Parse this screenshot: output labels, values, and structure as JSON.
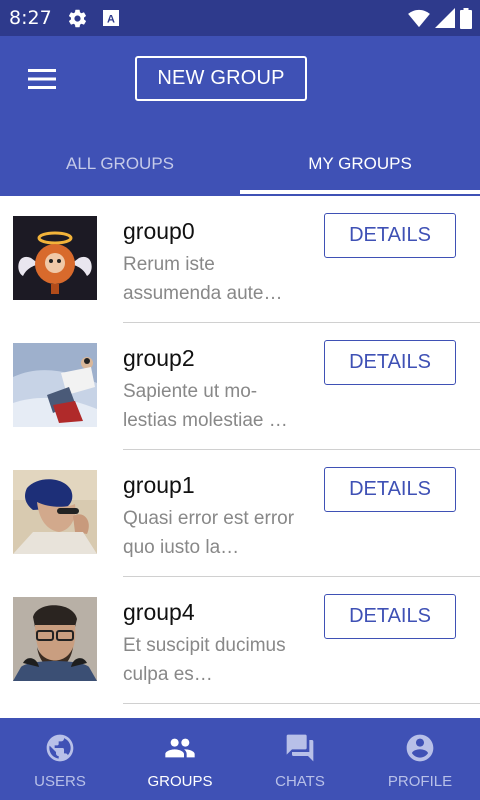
{
  "status_bar": {
    "time": "8:27",
    "left_icons": [
      "gear-icon",
      "a-badge-icon"
    ],
    "right_icons": [
      "wifi-icon",
      "signal-icon",
      "battery-icon"
    ]
  },
  "app_bar": {
    "menu_icon": "hamburger-menu-icon",
    "new_group_label": "NEW GROUP",
    "color": "#3f51b5"
  },
  "tabs": [
    {
      "label": "ALL GROUPS",
      "active": false
    },
    {
      "label": "MY GROUPS",
      "active": true
    }
  ],
  "groups": [
    {
      "name": "group0",
      "description": "Rerum iste assumenda aute…",
      "details_label": "DETAILS",
      "avatar_icon": "angel-character-avatar"
    },
    {
      "name": "group2",
      "description": "Sapiente ut mo- lestias molestiae …",
      "details_label": "DETAILS",
      "avatar_icon": "snow-person-avatar"
    },
    {
      "name": "group1",
      "description": "Quasi error est error quo iusto la…",
      "details_label": "DETAILS",
      "avatar_icon": "person-blue-hair-avatar"
    },
    {
      "name": "group4",
      "description": "Et suscipit ducimus culpa es…",
      "details_label": "DETAILS",
      "avatar_icon": "bearded-person-avatar"
    }
  ],
  "bottom_nav": [
    {
      "label": "USERS",
      "icon": "globe-icon",
      "active": false
    },
    {
      "label": "GROUPS",
      "icon": "people-icon",
      "active": true
    },
    {
      "label": "CHATS",
      "icon": "chat-icon",
      "active": false
    },
    {
      "label": "PROFILE",
      "icon": "account-circle-icon",
      "active": false
    }
  ],
  "colors": {
    "primary": "#3f51b5",
    "primary_dark": "#2e3a8c",
    "accent_text": "#3f51b5",
    "inactive_tab": "#c5cae9"
  }
}
